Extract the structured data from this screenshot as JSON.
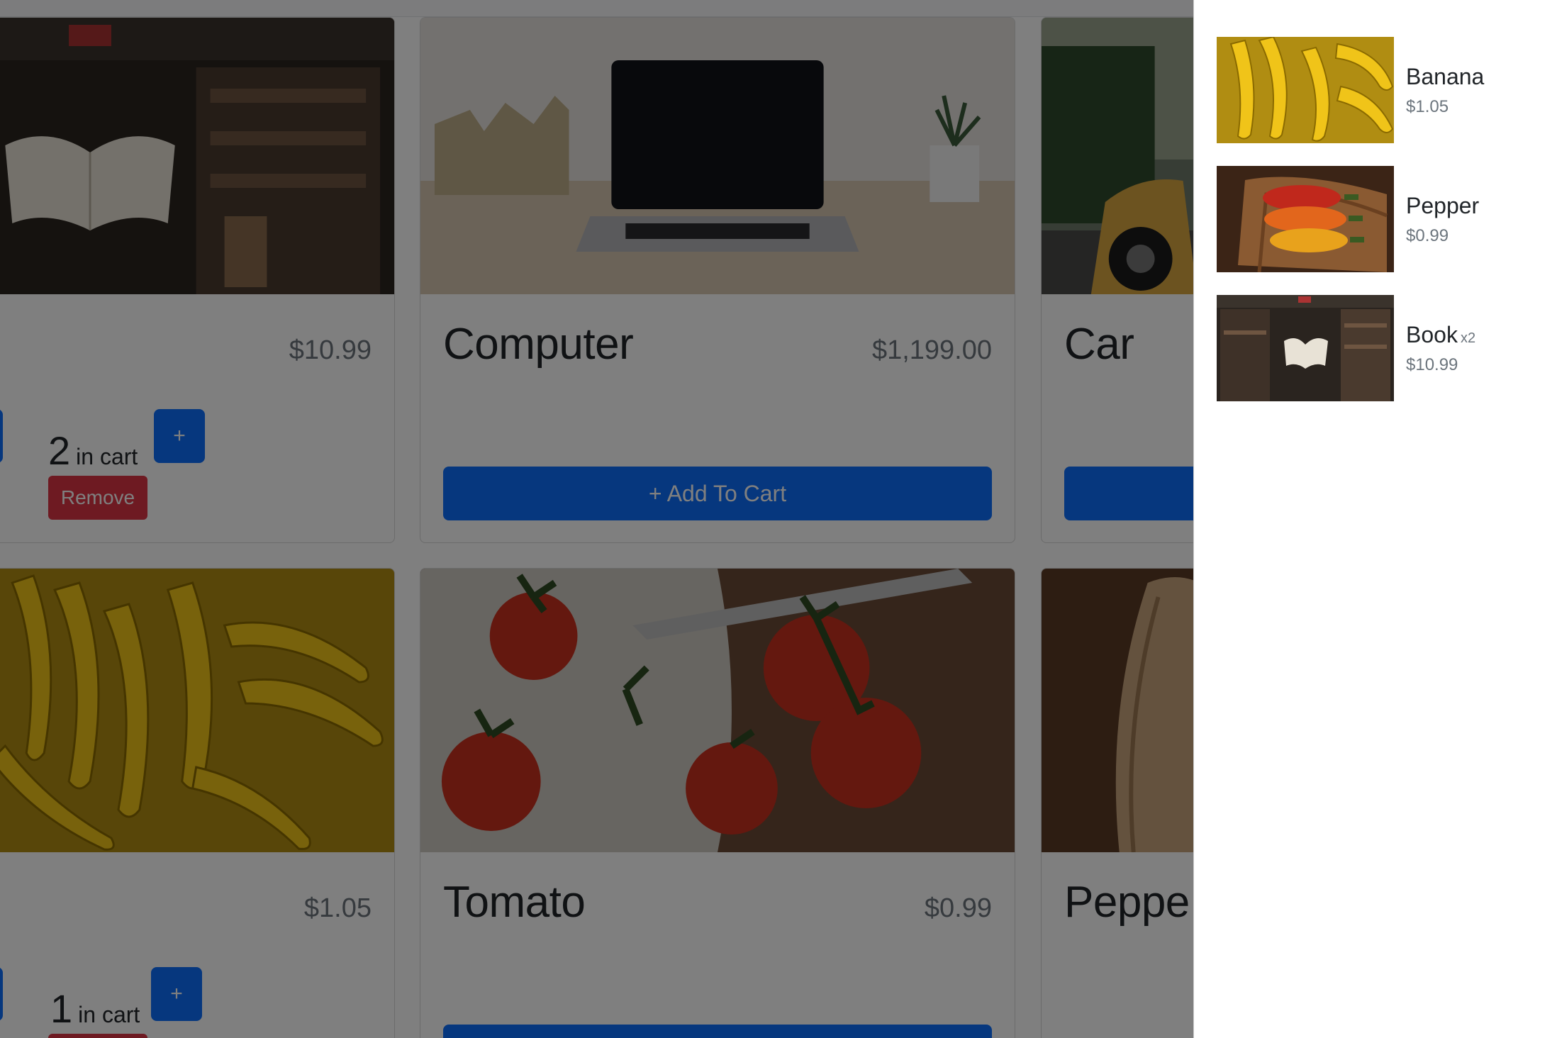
{
  "store": {
    "cards": [
      {
        "id": "book",
        "title": "",
        "price": "$10.99",
        "qty": "2",
        "qty_label": "in cart",
        "minus": "-",
        "plus": "+",
        "remove": "Remove"
      },
      {
        "id": "computer",
        "title": "Computer",
        "price": "$1,199.00",
        "add_label": "+ Add To Cart"
      },
      {
        "id": "car",
        "title": "Car"
      },
      {
        "id": "banana",
        "title": "",
        "price": "$1.05",
        "qty": "1",
        "qty_label": "in cart",
        "minus": "-",
        "plus": "+"
      },
      {
        "id": "tomato",
        "title": "Tomato",
        "price": "$0.99"
      },
      {
        "id": "pepper",
        "title": "Peppe"
      }
    ]
  },
  "cart": {
    "items": [
      {
        "name": "Banana",
        "qty": "",
        "price": "$1.05"
      },
      {
        "name": "Pepper",
        "qty": "",
        "price": "$0.99"
      },
      {
        "name": "Book",
        "qty": "x2",
        "price": "$10.99"
      }
    ]
  },
  "colors": {
    "primary": "#0d6efd",
    "danger": "#dc3545",
    "backdrop": "rgba(0,0,0,0.5)"
  }
}
